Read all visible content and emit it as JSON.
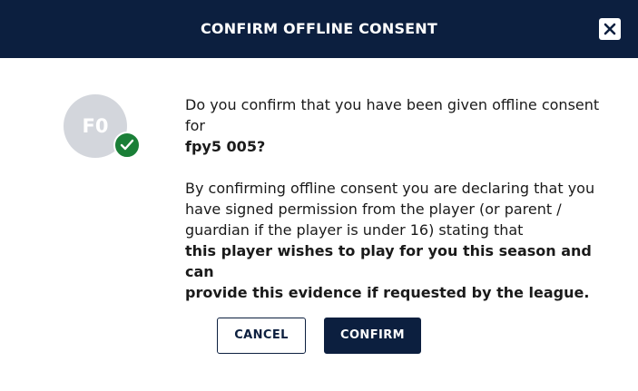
{
  "dialog": {
    "title": "CONFIRM OFFLINE CONSENT",
    "close_icon": "close-icon"
  },
  "avatar": {
    "initials": "F0",
    "badge_icon": "check-icon",
    "badge_color": "#1a7f37"
  },
  "body": {
    "question_line1": "Do you confirm that you have been given offline consent",
    "question_line2": "for",
    "player_name": "fpy5 005?",
    "declaration_line1": "By confirming offline consent you are declaring that you",
    "declaration_line2": "have signed permission from the player (or parent /",
    "declaration_line3": "guardian if the player is under 16) stating that",
    "declaration_bold_line1": "this player wishes to play for you this season and can",
    "declaration_bold_line2": "provide this evidence if requested by the league."
  },
  "actions": {
    "cancel_label": "CANCEL",
    "confirm_label": "CONFIRM"
  },
  "colors": {
    "header_bg": "#0c1f3f",
    "avatar_bg": "#d3d6dc",
    "primary": "#0c1f3f"
  }
}
